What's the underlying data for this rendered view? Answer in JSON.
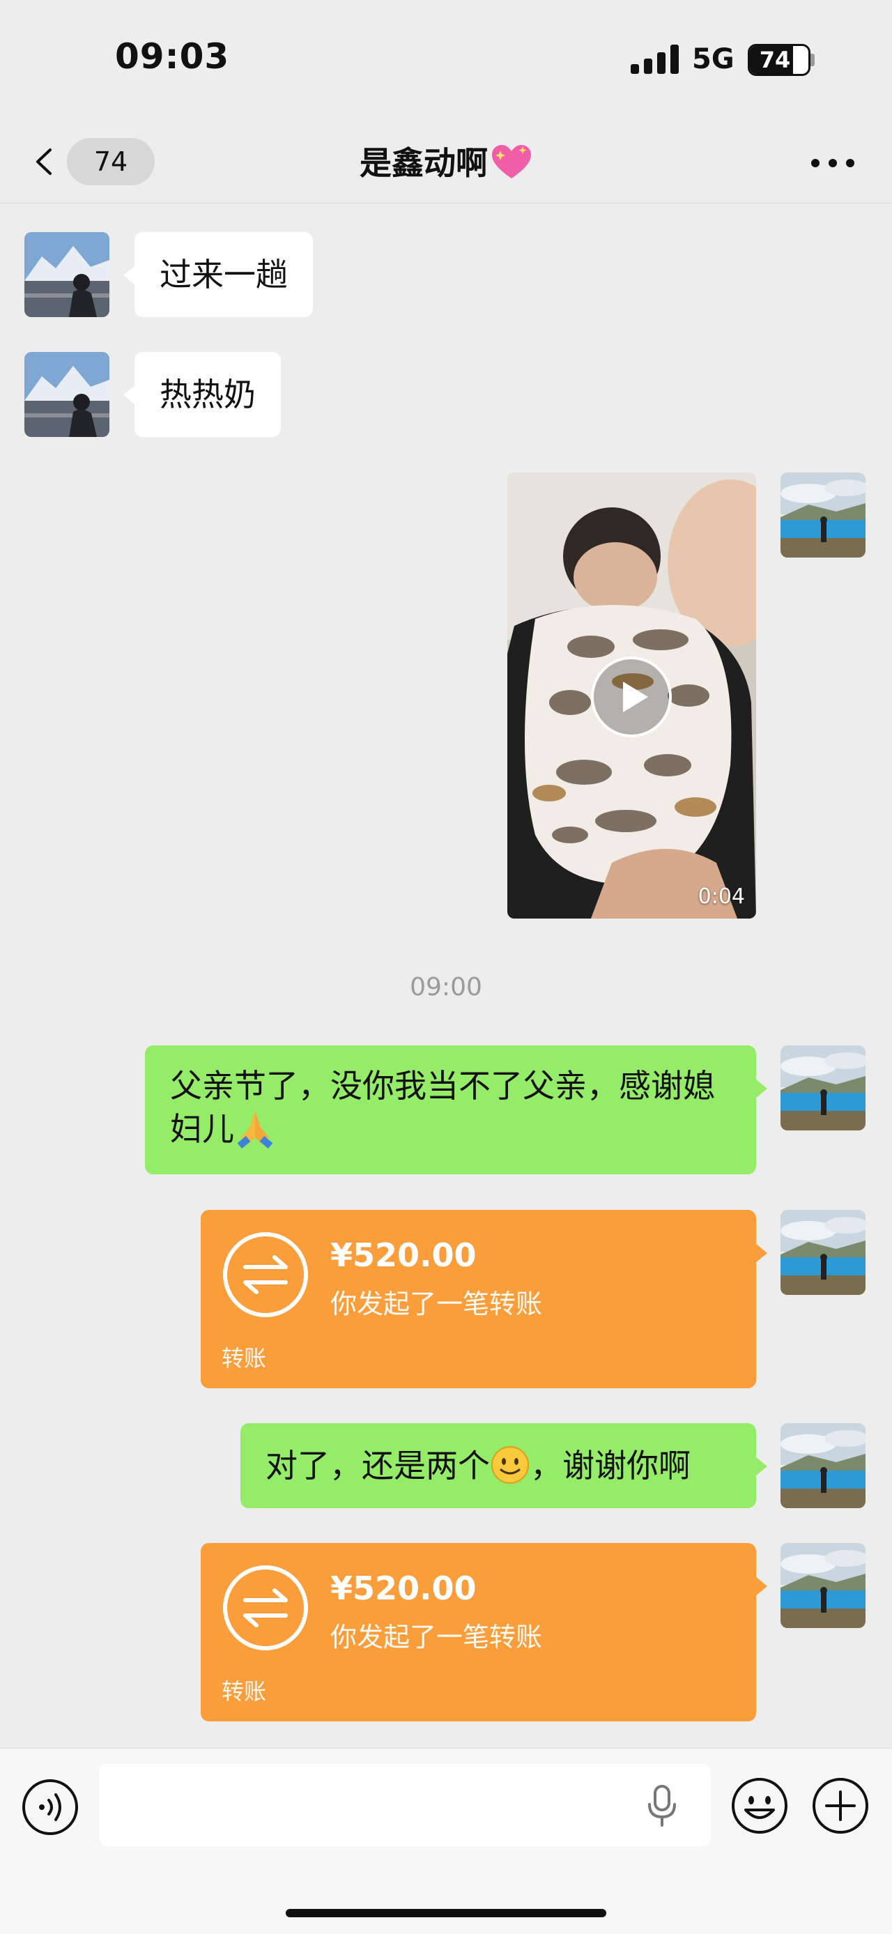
{
  "status_bar": {
    "time": "09:03",
    "network": "5G",
    "battery": "74",
    "battery_level_percent": 74
  },
  "nav": {
    "back_count": "74",
    "title": "是鑫动啊",
    "title_emoji_icon": "sparkling-heart-icon"
  },
  "messages": [
    {
      "side": "incoming",
      "type": "text",
      "text": "过来一趟"
    },
    {
      "side": "incoming",
      "type": "text",
      "text": "热热奶"
    },
    {
      "side": "outgoing",
      "type": "video",
      "duration": "0:04"
    },
    {
      "type": "timestamp",
      "text": "09:00"
    },
    {
      "side": "outgoing",
      "type": "text",
      "text": "父亲节了，没你我当不了父亲，感谢媳妇儿",
      "emoji_icon": "folded-hands-icon"
    },
    {
      "side": "outgoing",
      "type": "transfer",
      "amount": "¥520.00",
      "desc": "你发起了一笔转账",
      "label": "转账"
    },
    {
      "side": "outgoing",
      "type": "text",
      "text_before": "对了，还是两个",
      "emoji_icon": "smiling-face-icon",
      "text_after": "，谢谢你啊"
    },
    {
      "side": "outgoing",
      "type": "transfer",
      "amount": "¥520.00",
      "desc": "你发起了一笔转账",
      "label": "转账"
    }
  ],
  "colors": {
    "background": "#ededed",
    "outgoing_bubble": "#95ec69",
    "incoming_bubble": "#ffffff",
    "transfer_card": "#fa9d3b",
    "timestamp_text": "#9a9a9a"
  }
}
